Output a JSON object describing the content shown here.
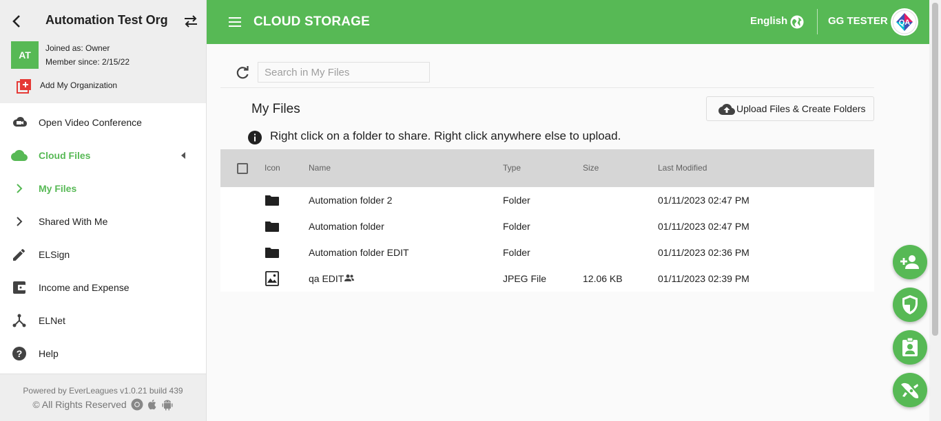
{
  "sidebar": {
    "org_name": "Automation Test Org",
    "avatar_initials": "AT",
    "joined_as": "Joined as: Owner",
    "member_since": "Member since: 2/15/22",
    "add_org": "Add My Organization",
    "items": [
      {
        "label": "Open Video Conference",
        "icon": "video-conference-icon"
      },
      {
        "label": "Cloud Files",
        "icon": "cloud-icon",
        "active": true
      },
      {
        "label": "My Files",
        "icon": "chevron-right-icon",
        "active": true
      },
      {
        "label": "Shared With Me",
        "icon": "chevron-right-icon"
      },
      {
        "label": "ELSign",
        "icon": "pencil-icon"
      },
      {
        "label": "Income and Expense",
        "icon": "wallet-icon"
      },
      {
        "label": "ELNet",
        "icon": "network-icon"
      },
      {
        "label": "Help",
        "icon": "help-icon"
      }
    ],
    "powered_by": "Powered by EverLeagues v1.0.21 build 439",
    "rights": "© All Rights Reserved"
  },
  "topbar": {
    "title": "CLOUD STORAGE",
    "language": "English",
    "user_name": "GG TESTER",
    "user_avatar_text": "QA"
  },
  "main": {
    "search_placeholder": "Search in My Files",
    "page_title": "My Files",
    "upload_label": "Upload Files & Create Folders",
    "info_text": "Right click on a folder to share. Right click anywhere else to upload.",
    "columns": {
      "icon": "Icon",
      "name": "Name",
      "type": "Type",
      "size": "Size",
      "modified": "Last Modified"
    },
    "rows": [
      {
        "icon": "folder-icon",
        "name": "Automation folder 2",
        "type": "Folder",
        "size": "",
        "modified": "01/11/2023 02:47 PM"
      },
      {
        "icon": "folder-icon",
        "name": "Automation folder",
        "type": "Folder",
        "size": "",
        "modified": "01/11/2023 02:47 PM"
      },
      {
        "icon": "folder-icon",
        "name": "Automation folder EDIT",
        "type": "Folder",
        "size": "",
        "modified": "01/11/2023 02:36 PM"
      },
      {
        "icon": "image-file-icon",
        "name": "qa EDIT",
        "shared": true,
        "type": "JPEG File",
        "size": "12.06 KB",
        "modified": "01/11/2023 02:39 PM"
      }
    ]
  },
  "colors": {
    "accent": "#57b955",
    "header_bg": "#d6d6d6",
    "sidebar_head": "#eeeeee"
  },
  "fabs": [
    "add-person-icon",
    "shield-icon",
    "contact-badge-icon",
    "rocket-icon"
  ]
}
